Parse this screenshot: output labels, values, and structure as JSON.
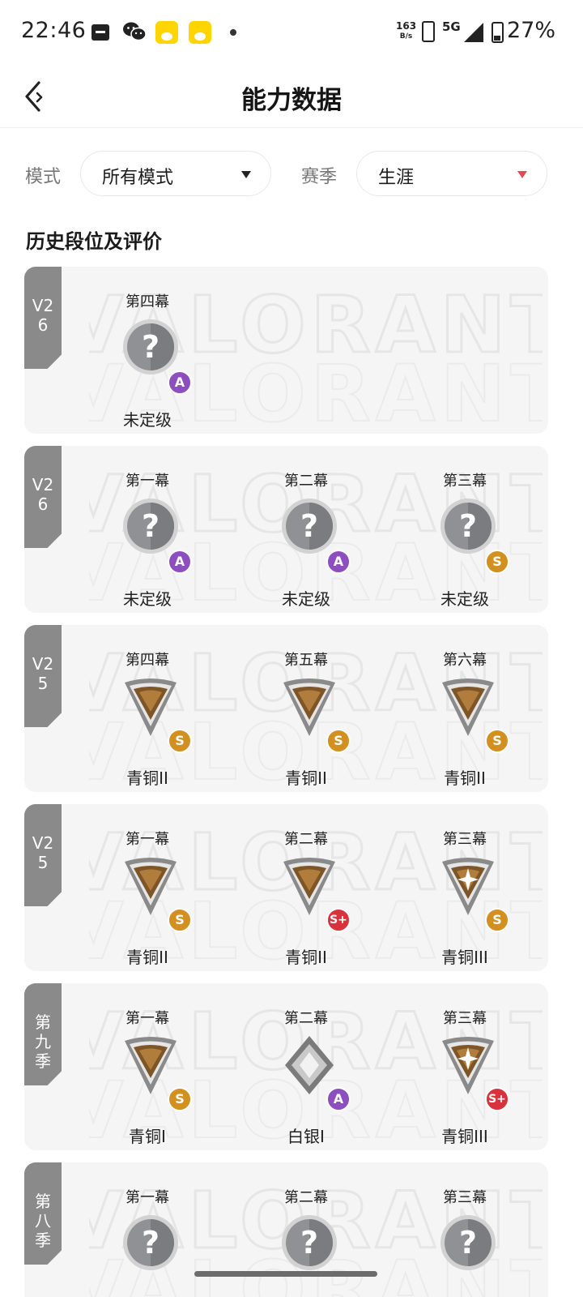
{
  "status_bar": {
    "time": "22:46",
    "net_speed_value": "163",
    "net_speed_unit": "B/s",
    "network": "5G",
    "battery": "27%",
    "icons": [
      "message-icon",
      "wechat-icon",
      "app-icon",
      "app-icon",
      "dot-icon",
      "vibrate-icon",
      "signal-icon",
      "battery-icon"
    ]
  },
  "header": {
    "title": "能力数据",
    "back_icon": "back-arrow-icon"
  },
  "filters": {
    "mode_label": "模式",
    "mode_value": "所有模式",
    "season_label": "赛季",
    "season_value": "生涯"
  },
  "section_title": "历史段位及评价",
  "colors": {
    "tab_grey": "#8a8a8a",
    "grade_a": "#8d4fc0",
    "grade_s": "#d19020",
    "grade_s_plus": "#d8323c",
    "caret_red": "#e34a59"
  },
  "cards": [
    {
      "season": "V26",
      "acts": [
        {
          "act": "第四幕",
          "rank": "未定级",
          "icon": "unranked-icon",
          "grade": "A"
        }
      ]
    },
    {
      "season": "V26",
      "acts": [
        {
          "act": "第一幕",
          "rank": "未定级",
          "icon": "unranked-icon",
          "grade": "A"
        },
        {
          "act": "第二幕",
          "rank": "未定级",
          "icon": "unranked-icon",
          "grade": "A"
        },
        {
          "act": "第三幕",
          "rank": "未定级",
          "icon": "unranked-icon",
          "grade": "S"
        }
      ]
    },
    {
      "season": "V25",
      "acts": [
        {
          "act": "第四幕",
          "rank": "青铜II",
          "icon": "bronze-icon",
          "grade": "S"
        },
        {
          "act": "第五幕",
          "rank": "青铜II",
          "icon": "bronze-icon",
          "grade": "S"
        },
        {
          "act": "第六幕",
          "rank": "青铜II",
          "icon": "bronze-icon",
          "grade": "S"
        }
      ]
    },
    {
      "season": "V25",
      "acts": [
        {
          "act": "第一幕",
          "rank": "青铜II",
          "icon": "bronze-icon",
          "grade": "S"
        },
        {
          "act": "第二幕",
          "rank": "青铜II",
          "icon": "bronze-icon",
          "grade": "S+"
        },
        {
          "act": "第三幕",
          "rank": "青铜III",
          "icon": "bronze-star-icon",
          "grade": "S"
        }
      ]
    },
    {
      "season": "第九季",
      "acts": [
        {
          "act": "第一幕",
          "rank": "青铜I",
          "icon": "bronze-icon",
          "grade": "S"
        },
        {
          "act": "第二幕",
          "rank": "白银I",
          "icon": "silver-icon",
          "grade": "A"
        },
        {
          "act": "第三幕",
          "rank": "青铜III",
          "icon": "bronze-star-icon",
          "grade": "S+"
        }
      ]
    },
    {
      "season": "第八季",
      "acts": [
        {
          "act": "第一幕",
          "rank": "",
          "icon": "unranked-icon",
          "grade": ""
        },
        {
          "act": "第二幕",
          "rank": "",
          "icon": "unranked-icon",
          "grade": ""
        },
        {
          "act": "第三幕",
          "rank": "",
          "icon": "unranked-icon",
          "grade": ""
        }
      ]
    }
  ]
}
